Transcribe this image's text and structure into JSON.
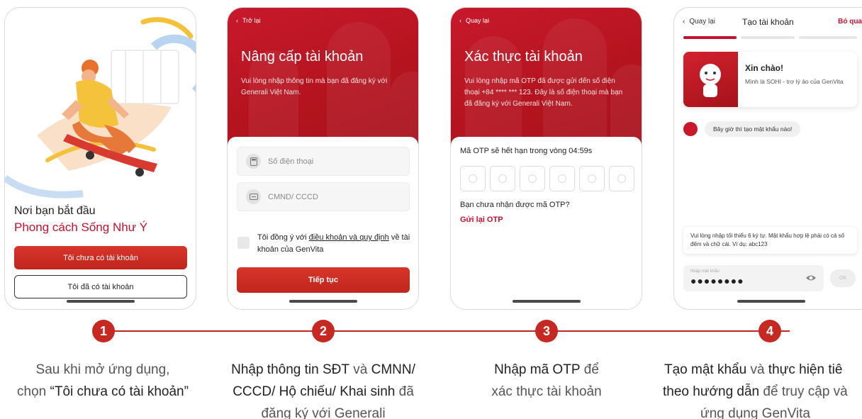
{
  "screen1": {
    "headline": "Nơi bạn bắt đầu",
    "tagline": "Phong cách Sống Như Ý",
    "primary_button": "Tôi chưa có tài khoản",
    "secondary_button": "Tôi đã có tài khoản"
  },
  "screen2": {
    "back_label": "Trở lại",
    "title": "Nâng cấp tài khoản",
    "description": "Vui lòng nhập thông tin mà bạn đã đăng ký với Generali Việt Nam.",
    "phone_placeholder": "Số điện thoại",
    "id_placeholder": "CMND/ CCCD",
    "terms_prefix": "Tôi đồng ý với ",
    "terms_link": "điều khoản và quy định",
    "terms_suffix": " về tài khoản của GenVita",
    "continue_button": "Tiếp tục"
  },
  "screen3": {
    "back_label": "Quay lại",
    "title": "Xác thực tài khoản",
    "description": "Vui lòng nhập mã OTP đã được gửi đến số điện thoại +84 **** *** 123. Đây là số điện thoại mà bạn đã đăng ký với Generali Việt Nam.",
    "expiry_text": "Mã OTP sẽ hết hạn trong vòng 04:59s",
    "not_received": "Bạn chưa nhận được mã OTP?",
    "resend": "Gửi lại OTP"
  },
  "screen4": {
    "back_label": "Quay lại",
    "title": "Tạo tài khoản",
    "skip": "Bỏ qua",
    "greeting": "Xin chào!",
    "intro": "Mình là SOHI - trợ lý ảo của GenVita",
    "bot_message": "Bây giờ thì tạo mật khẩu nào!",
    "hint": "Vui lòng nhập tối thiểu 6 ký tự. Mật khẩu hợp lệ phải có cả số đếm và chữ cái. Ví dụ: abc123",
    "password_label": "Nhập mật khẩu",
    "password_value": "●●●●●●●●",
    "ok_button": "OK",
    "progress_steps": 3,
    "progress_current": 1
  },
  "steps": [
    {
      "number": "1"
    },
    {
      "number": "2"
    },
    {
      "number": "3"
    },
    {
      "number": "4"
    }
  ],
  "captions": {
    "c1_line1": "Sau khi mở ứng dụng,",
    "c1_pre": "chọn ",
    "c1_bold": "“Tôi chưa có tài khoản”",
    "c2_bold1": "Nhập thông tin SĐT",
    "c2_mid": " và ",
    "c2_bold2": "CMNN/",
    "c2_bold3": "CCCD/ Hộ chiếu/ Khai sinh",
    "c2_tail": " đã",
    "c2_line3": "đăng ký với Generali",
    "c3_bold": "Nhập mã OTP",
    "c3_tail": " để",
    "c3_line2": "xác thực tài khoản",
    "c4_bold1": "Tạo mật khẩu",
    "c4_mid": " và ",
    "c4_bold2": "thực hiện tiê",
    "c4_bold3": "theo hướng dẫn",
    "c4_tail": " để truy cập và",
    "c4_line3": "ứng dụng GenVita"
  },
  "colors": {
    "brand_red": "#c8102e",
    "accent_blue": "#b8d4f0"
  }
}
